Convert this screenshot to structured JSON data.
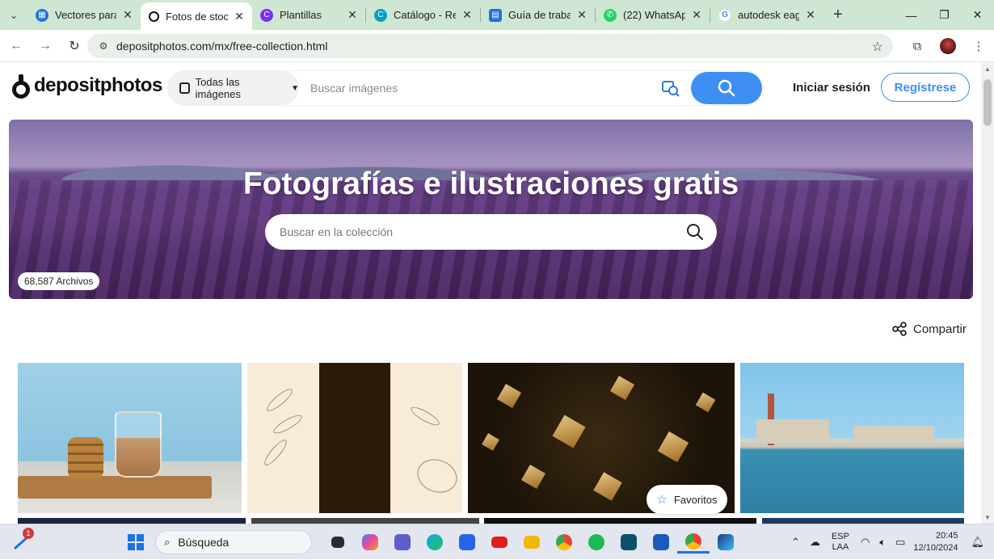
{
  "browser": {
    "tabs": [
      {
        "title": "Vectores para de",
        "favicon": "vector-site-icon",
        "color": "#1a73e8",
        "active": false
      },
      {
        "title": "Fotos de stock e",
        "favicon": "depositphotos-icon",
        "color": "#111111",
        "active": true
      },
      {
        "title": "Plantillas",
        "favicon": "canva-icon",
        "color": "#7b2ff7",
        "active": false
      },
      {
        "title": "Catálogo - Revis",
        "favicon": "canva-icon",
        "color": "#00c4cc",
        "active": false
      },
      {
        "title": "Guía de trabajo",
        "favicon": "doc-icon",
        "color": "#1a73e8",
        "active": false
      },
      {
        "title": "(22) WhatsApp",
        "favicon": "whatsapp-icon",
        "color": "#25d366",
        "active": false
      },
      {
        "title": "autodesk eagle",
        "favicon": "google-icon",
        "color": "#ffffff",
        "active": false
      }
    ],
    "url": "depositphotos.com/mx/free-collection.html"
  },
  "site": {
    "logo_text": "depositphotos",
    "category_label": "Todas las imágenes",
    "search_placeholder": "Buscar imágenes",
    "signin_label": "Iniciar sesión",
    "register_label": "Regístrese",
    "accent": "#3f8ef4"
  },
  "hero": {
    "title": "Fotografías e ilustraciones gratis",
    "search_placeholder": "Buscar en la colección",
    "files_count": "68,587 Archivos"
  },
  "share_label": "Compartir",
  "favorites_label": "Favoritos",
  "taskbar": {
    "notification_count": "1",
    "search_label": "Búsqueda",
    "lang_top": "ESP",
    "lang_bottom": "LAA",
    "time": "20:45",
    "date": "12/10/2024"
  }
}
